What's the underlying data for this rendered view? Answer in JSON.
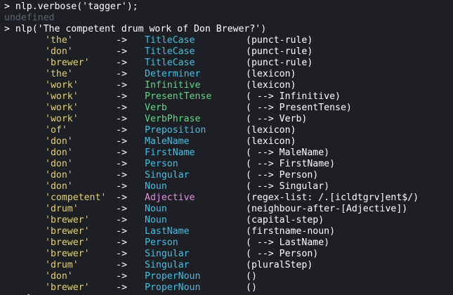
{
  "colors": {
    "background": "#1d1f24",
    "token": "#e5d36a",
    "cyan_tag": "#3fc1e6",
    "green_tag": "#5fd787",
    "magenta_tag": "#e58fe5",
    "muted": "#5c6470"
  },
  "console": {
    "line1": {
      "prompt": ">",
      "command": "nlp.verbose('tagger');"
    },
    "line2": {
      "output": "undefined"
    },
    "line3": {
      "prompt": ">",
      "command": "nlp('The competent drum work of Don Brewer?')"
    }
  },
  "rows": [
    {
      "token": "'the'",
      "arrow": "->",
      "tag": "TitleCase",
      "reason": "(punct-rule)",
      "color": "cyan"
    },
    {
      "token": "'don'",
      "arrow": "->",
      "tag": "TitleCase",
      "reason": "(punct-rule)",
      "color": "cyan"
    },
    {
      "token": "'brewer'",
      "arrow": "->",
      "tag": "TitleCase",
      "reason": "(punct-rule)",
      "color": "cyan"
    },
    {
      "token": "'the'",
      "arrow": "->",
      "tag": "Determiner",
      "reason": "(lexicon)",
      "color": "cyan"
    },
    {
      "token": "'work'",
      "arrow": "->",
      "tag": "Infinitive",
      "reason": "(lexicon)",
      "color": "green"
    },
    {
      "token": "'work'",
      "arrow": "->",
      "tag": "PresentTense",
      "reason": "( --> Infinitive)",
      "color": "green"
    },
    {
      "token": "'work'",
      "arrow": "->",
      "tag": "Verb",
      "reason": "( --> PresentTense)",
      "color": "green"
    },
    {
      "token": "'work'",
      "arrow": "->",
      "tag": "VerbPhrase",
      "reason": "( --> Verb)",
      "color": "green"
    },
    {
      "token": "'of'",
      "arrow": "->",
      "tag": "Preposition",
      "reason": "(lexicon)",
      "color": "cyan"
    },
    {
      "token": "'don'",
      "arrow": "->",
      "tag": "MaleName",
      "reason": "(lexicon)",
      "color": "cyan"
    },
    {
      "token": "'don'",
      "arrow": "->",
      "tag": "FirstName",
      "reason": "( --> MaleName)",
      "color": "cyan"
    },
    {
      "token": "'don'",
      "arrow": "->",
      "tag": "Person",
      "reason": "( --> FirstName)",
      "color": "cyan"
    },
    {
      "token": "'don'",
      "arrow": "->",
      "tag": "Singular",
      "reason": "( --> Person)",
      "color": "cyan"
    },
    {
      "token": "'don'",
      "arrow": "->",
      "tag": "Noun",
      "reason": "( --> Singular)",
      "color": "cyan"
    },
    {
      "token": "'competent'",
      "arrow": "->",
      "tag": "Adjective",
      "reason": "(regex-list: /.[icldtgrv]ent$/)",
      "color": "magenta"
    },
    {
      "token": "'drum'",
      "arrow": "->",
      "tag": "Noun",
      "reason": "(neighbour-after-[Adjective])",
      "color": "cyan"
    },
    {
      "token": "'brewer'",
      "arrow": "->",
      "tag": "Noun",
      "reason": "(capital-step)",
      "color": "cyan"
    },
    {
      "token": "'brewer'",
      "arrow": "->",
      "tag": "LastName",
      "reason": "(firstname-noun)",
      "color": "cyan"
    },
    {
      "token": "'brewer'",
      "arrow": "->",
      "tag": "Person",
      "reason": "( --> LastName)",
      "color": "cyan"
    },
    {
      "token": "'brewer'",
      "arrow": "->",
      "tag": "Singular",
      "reason": "( --> Person)",
      "color": "cyan"
    },
    {
      "token": "'drum'",
      "arrow": "->",
      "tag": "Singular",
      "reason": "(pluralStep)",
      "color": "cyan"
    },
    {
      "token": "'don'",
      "arrow": "->",
      "tag": "ProperNoun",
      "reason": "()",
      "color": "cyan"
    },
    {
      "token": "'brewer'",
      "arrow": "->",
      "tag": "ProperNoun",
      "reason": "()",
      "color": "cyan"
    }
  ],
  "tail": "},"
}
